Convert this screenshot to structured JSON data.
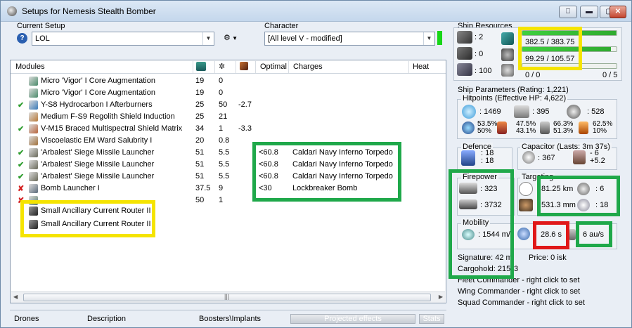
{
  "window": {
    "title": "Setups for Nemesis Stealth Bomber"
  },
  "setup": {
    "label": "Current Setup",
    "value": "LOL"
  },
  "character": {
    "label": "Character",
    "value": "[All level V - modified]"
  },
  "modules": {
    "headers": {
      "name": "Modules",
      "optimal": "Optimal",
      "charges": "Charges",
      "heat": "Heat"
    },
    "rows": [
      {
        "status": "",
        "name": "Micro 'Vigor' I Core Augmentation",
        "c1": "19",
        "c2": "0",
        "c3": "",
        "optimal": "",
        "charge": "",
        "icon": "#4a8a6a"
      },
      {
        "status": "",
        "name": "Micro 'Vigor' I Core Augmentation",
        "c1": "19",
        "c2": "0",
        "c3": "",
        "optimal": "",
        "charge": "",
        "icon": "#4a8a6a"
      },
      {
        "status": "✔",
        "name": "Y-S8 Hydrocarbon I Afterburners",
        "c1": "25",
        "c2": "50",
        "c3": "-2.7",
        "optimal": "",
        "charge": "",
        "icon": "#3a7ab8"
      },
      {
        "status": "",
        "name": "Medium F-S9 Regolith Shield Induction",
        "c1": "25",
        "c2": "21",
        "c3": "",
        "optimal": "",
        "charge": "",
        "icon": "#b87a3a"
      },
      {
        "status": "✔",
        "name": "V-M15 Braced Multispectral Shield Matrix",
        "c1": "34",
        "c2": "1",
        "c3": "-3.3",
        "optimal": "",
        "charge": "",
        "icon": "#b8643a"
      },
      {
        "status": "",
        "name": "Viscoelastic EM Ward Salubrity I",
        "c1": "20",
        "c2": "0.8",
        "c3": "",
        "optimal": "",
        "charge": "",
        "icon": "#a0703a"
      },
      {
        "status": "✔",
        "name": "'Arbalest' Siege Missile Launcher",
        "c1": "51",
        "c2": "5.5",
        "c3": "",
        "optimal": "<60.8",
        "charge": "Caldari Navy Inferno Torpedo",
        "icon": "#6a6a5a"
      },
      {
        "status": "✔",
        "name": "'Arbalest' Siege Missile Launcher",
        "c1": "51",
        "c2": "5.5",
        "c3": "",
        "optimal": "<60.8",
        "charge": "Caldari Navy Inferno Torpedo",
        "icon": "#6a6a5a"
      },
      {
        "status": "✔",
        "name": "'Arbalest' Siege Missile Launcher",
        "c1": "51",
        "c2": "5.5",
        "c3": "",
        "optimal": "<60.8",
        "charge": "Caldari Navy Inferno Torpedo",
        "icon": "#6a6a5a"
      },
      {
        "status": "✘",
        "name": "Bomb Launcher I",
        "c1": "37.5",
        "c2": "9",
        "c3": "",
        "optimal": "<30",
        "charge": "Lockbreaker Bomb",
        "icon": "#5a6a7a"
      },
      {
        "status": "✘",
        "name": "",
        "c1": "50",
        "c2": "1",
        "c3": "",
        "optimal": "",
        "charge": "",
        "icon": "#5a7a6a"
      }
    ],
    "rigs": [
      "Small Ancillary Current Router II",
      "Small Ancillary Current Router II"
    ]
  },
  "bottom_tabs": [
    "Drones",
    "Description",
    "Boosters\\Implants",
    "Projected effects",
    "Stats"
  ],
  "resources": {
    "label": "Ship Resources",
    "turrets": ": 2",
    "launchers": ": 0",
    "drones": ": 100",
    "cpu": "382.5 / 383.75",
    "power": "99.29 / 105.57",
    "calibration": "0 / 0",
    "drone_slots": "0 / 5",
    "cpu_fill": 0.997,
    "power_fill": 0.94
  },
  "params": {
    "label": "Ship Parameters (Rating: 1,221)",
    "hp_label": "Hitpoints (Effective HP: 4,622)",
    "shield_hp": ": 1469",
    "armor_hp": ": 395",
    "hull_hp": ": 528",
    "res1": "53.5%",
    "res1b": "50%",
    "res2": "47.5%",
    "res2b": "43.1%",
    "res3": "66.3%",
    "res3b": "51.3%",
    "res4": "62.5%",
    "res4b": "10%",
    "defence_label": "Defence",
    "def1": ": 18",
    "def2": ": 18",
    "cap_label": "Capacitor (Lasts: 3m 37s)",
    "cap": ": 367",
    "cap_delta": "- 6",
    "cap_delta2": "+5.2",
    "firepower_label": "Firepower",
    "fp1": ": 323",
    "fp2": ": 3732",
    "targeting_label": "Targeting",
    "t_range": "81.25 km",
    "t_targets": ": 6",
    "t_res": "531.3 mm",
    "t_sensor": ": 18",
    "mobility_label": "Mobility",
    "speed": ": 1544 m/",
    "align": "28.6 s",
    "warp": "6 au/s",
    "signature": "Signature: 42 m",
    "price": "Price: 0 isk",
    "cargo": "Cargohold: 215",
    "cargo_tail": "3",
    "fleet_cmd": "Fleet Commander - right click to set",
    "wing_cmd": "Wing Commander - right click to set",
    "squad_cmd": "Squad Commander - right click to set"
  }
}
